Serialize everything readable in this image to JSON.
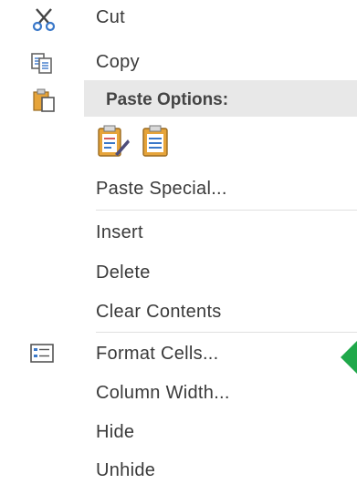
{
  "menu": {
    "cut": "Cut",
    "copy": "Copy",
    "paste_options": "Paste Options:",
    "paste_special": "Paste Special...",
    "insert": "Insert",
    "delete": "Delete",
    "clear_contents": "Clear Contents",
    "format_cells": "Format Cells...",
    "column_width": "Column Width...",
    "hide": "Hide",
    "unhide": "Unhide"
  },
  "icons": {
    "cut": "scissors-icon",
    "copy": "copy-icon",
    "paste_options": "clipboard-icon",
    "paste_formatting": "paste-formatting-icon",
    "paste_values": "paste-values-icon",
    "format_cells": "format-cells-icon",
    "pointer": "green-arrow-pointer"
  },
  "colors": {
    "header_bg": "#e8e8e8",
    "text": "#3a3a3a",
    "clipboard_orange": "#e6a43a",
    "pointer_green": "#1fa84a"
  }
}
